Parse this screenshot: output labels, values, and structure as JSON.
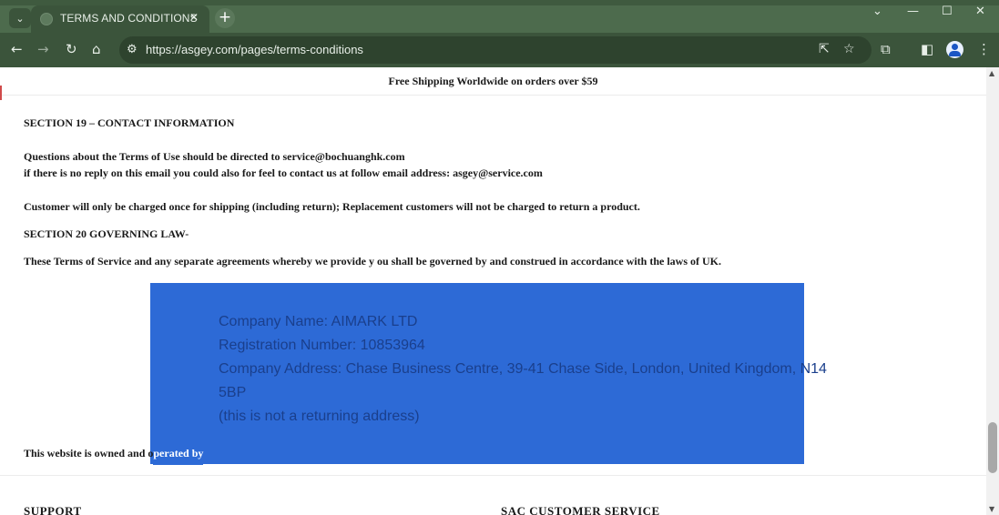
{
  "browser": {
    "tab_title": "TERMS AND CONDITIONS",
    "url": "https://asgey.com/pages/terms-conditions"
  },
  "page": {
    "promo": "Free Shipping Worldwide on orders over $59",
    "section19_heading": "SECTION 19 – CONTACT INFORMATION",
    "contact_line1": "Questions about the Terms of Use should be directed to service@bochuanghk.com",
    "contact_line2": "if there is no reply on this email you could also for feel to contact us at follow email address:  asgey@service.com",
    "shipping_note": "Customer will only be charged once for shipping (including return); Replacement customers will not be charged to return a product.",
    "section20_heading": "SECTION 20 GOVERNING LAW-",
    "governing_text": "These Terms of Service and any separate agreements whereby we provide y ou shall be governed by and construed in accordance with the laws of UK.",
    "company_name": "Company Name: AIMARK LTD",
    "registration": "Registration Number: 10853964",
    "address_line1": "Company Address: Chase Business Centre, 39-41 Chase Side, London, United Kingdom, N14",
    "address_line2": "5BP",
    "not_returning": "(this is not a returning address)",
    "owned_prefix": "This website is owned and o",
    "owned_highlight": "perated by"
  },
  "footer": {
    "support": "SUPPORT",
    "customer_service": "SAC CUSTOMER SERVICE"
  }
}
